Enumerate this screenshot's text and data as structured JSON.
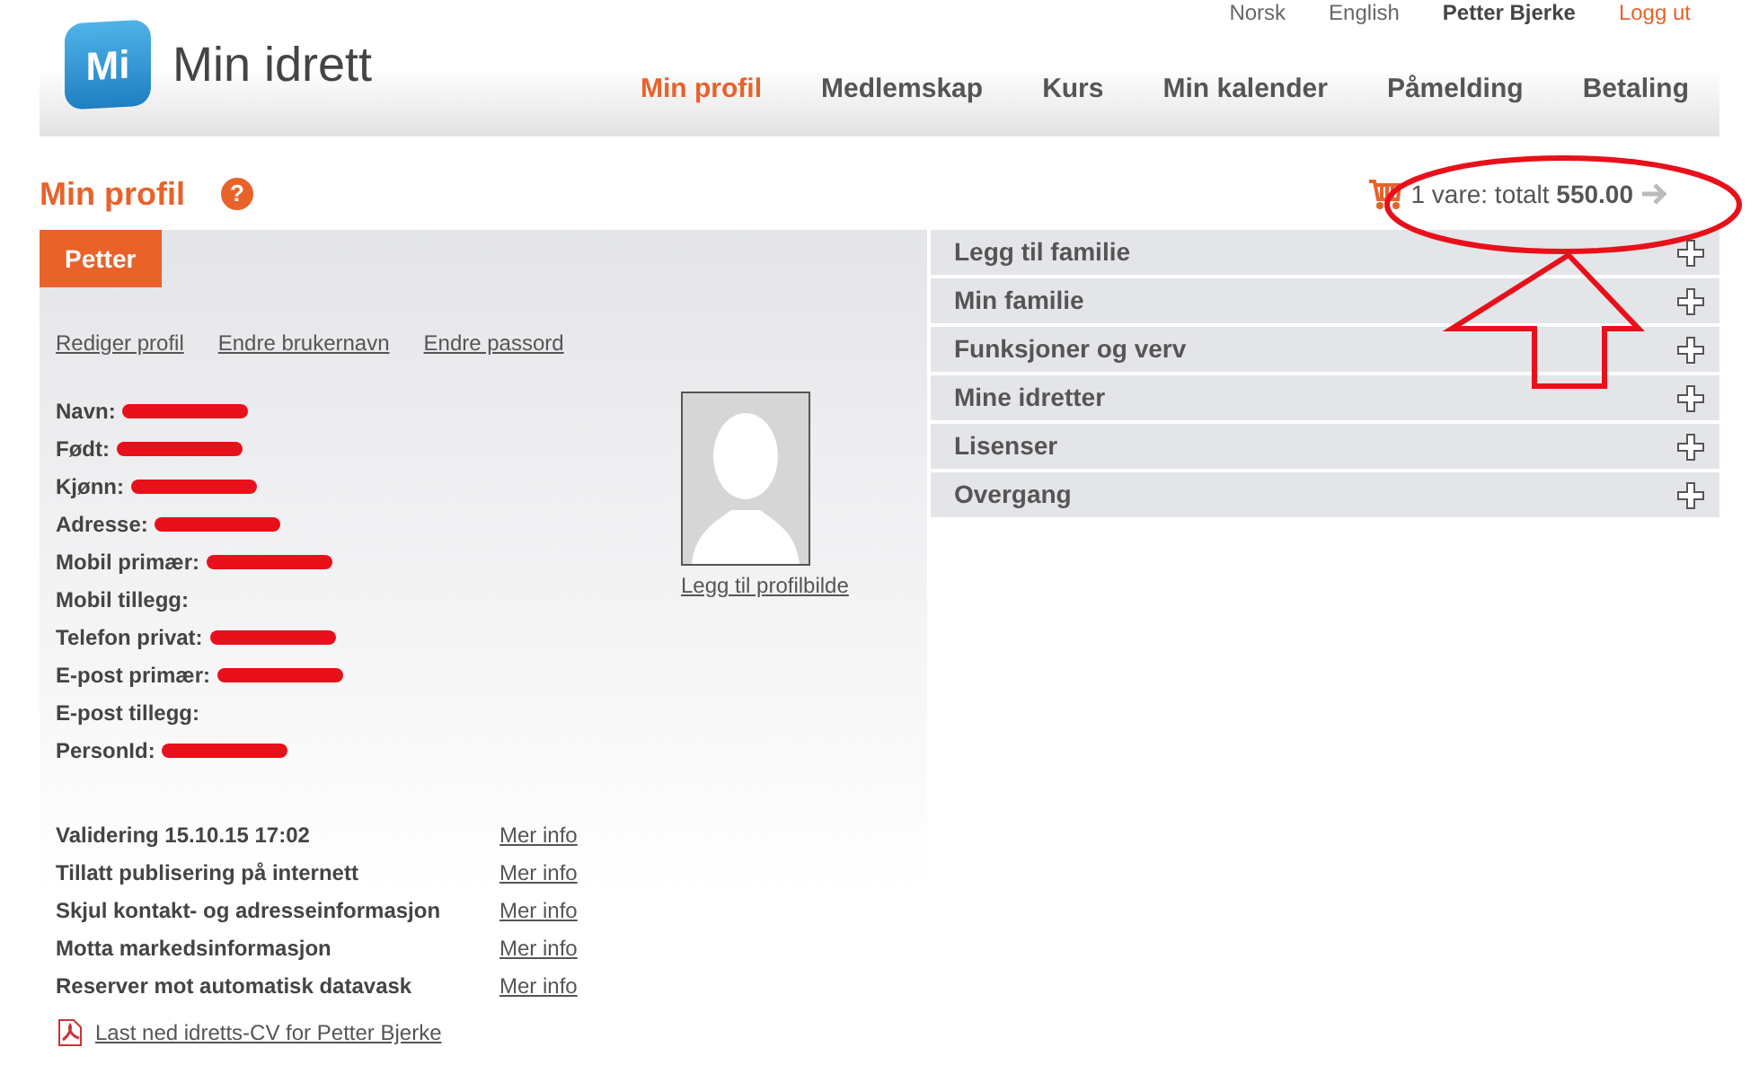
{
  "top_links": [
    {
      "label": "Norsk",
      "kind": "plain"
    },
    {
      "label": "English",
      "kind": "plain"
    },
    {
      "label": "Petter Bjerke",
      "kind": "user"
    },
    {
      "label": "Logg ut",
      "kind": "logout"
    }
  ],
  "logo": {
    "mark": "Mi",
    "name": "Min idrett"
  },
  "nav": [
    {
      "label": "Min profil",
      "selected": true
    },
    {
      "label": "Medlemskap",
      "selected": false
    },
    {
      "label": "Kurs",
      "selected": false
    },
    {
      "label": "Min kalender",
      "selected": false
    },
    {
      "label": "Påmelding",
      "selected": false
    },
    {
      "label": "Betaling",
      "selected": false
    }
  ],
  "page_title": "Min profil",
  "help_icon": "?",
  "cart": {
    "text": "1 vare: totalt **550.00**"
  },
  "profile": {
    "tab": "Petter",
    "links": [
      "Rediger profil",
      "Endre brukernavn",
      "Endre passord"
    ],
    "fields": [
      {
        "label": "Navn:",
        "redacted": true
      },
      {
        "label": "Født:",
        "redacted": true
      },
      {
        "label": "Kjønn:",
        "redacted": true
      },
      {
        "label": "Adresse:",
        "redacted": true
      },
      {
        "label": "Mobil primær:",
        "redacted": true
      },
      {
        "label": "Mobil tillegg:",
        "redacted": false
      },
      {
        "label": "Telefon privat:",
        "redacted": true
      },
      {
        "label": "E-post primær:",
        "redacted": true
      },
      {
        "label": "E-post tillegg:",
        "redacted": false
      },
      {
        "label": "PersonId:",
        "redacted": true
      }
    ],
    "photo_link": "Legg til profilbilde",
    "settings": [
      {
        "label": "Validering 15.10.15 17:02",
        "link": "Mer info"
      },
      {
        "label": "Tillatt publisering på internett",
        "link": "Mer info"
      },
      {
        "label": "Skjul kontakt- og adresseinformasjon",
        "link": "Mer info"
      },
      {
        "label": "Motta markedsinformasjon",
        "link": "Mer info"
      },
      {
        "label": "Reserver mot automatisk datavask",
        "link": "Mer info"
      }
    ],
    "cv_link": "Last ned idretts-CV for Petter Bjerke"
  },
  "sections": [
    {
      "label": "Legg til familie",
      "expanded": false
    },
    {
      "label": "Min familie",
      "expanded": false
    },
    {
      "label": "Funksjoner og verv",
      "expanded": false
    },
    {
      "label": "Mine idretter",
      "expanded": false
    },
    {
      "label": "Lisenser",
      "expanded": false
    },
    {
      "label": "Overgang",
      "expanded": false
    }
  ]
}
